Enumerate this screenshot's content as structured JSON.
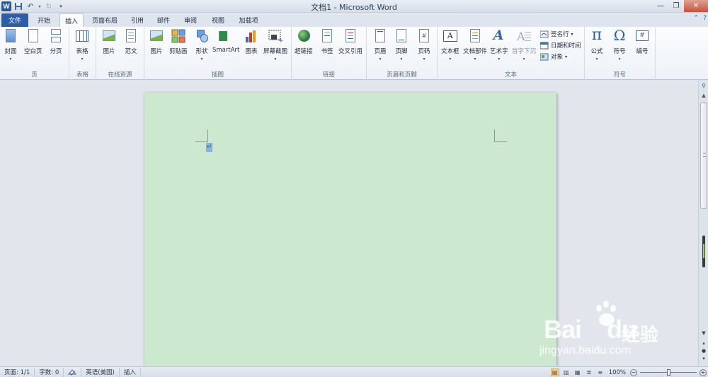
{
  "window": {
    "title": "文档1 - Microsoft Word",
    "app_logo": "W",
    "controls": [
      "—",
      "❐",
      "✕"
    ]
  },
  "tabs": {
    "file": "文件",
    "items": [
      "开始",
      "插入",
      "页面布局",
      "引用",
      "邮件",
      "审阅",
      "视图",
      "加载项"
    ],
    "active": "插入"
  },
  "ribbon": {
    "groups": {
      "page": "页",
      "table": "表格",
      "online": "在线资源",
      "illustrations": "插图",
      "links": "链接",
      "header_footer": "页眉和页脚",
      "text": "文本",
      "symbols": "符号"
    },
    "buttons": {
      "cover": "封面",
      "blank_page": "空白页",
      "page_break": "分页",
      "table": "表格",
      "online_picture": "图片",
      "template": "范文",
      "picture": "图片",
      "clip_art": "剪贴画",
      "shapes": "形状",
      "smartart": "SmartArt",
      "chart": "图表",
      "screenshot": "屏幕截图",
      "hyperlink": "超链接",
      "bookmark": "书签",
      "cross_ref": "交叉引用",
      "header": "页眉",
      "footer": "页脚",
      "page_number": "页码",
      "text_box": "文本框",
      "quick_parts": "文档部件",
      "wordart": "艺术字",
      "drop_cap": "首字下沉",
      "signature": "签名行",
      "date_time": "日期和时间",
      "object": "对象",
      "equation": "公式",
      "symbol": "符号",
      "number": "编号"
    },
    "dropdown_arrow": "▾"
  },
  "document": {
    "paragraph_mark": "↵",
    "page_color": "#cce8cf"
  },
  "status": {
    "page": "页面: 1/1",
    "words": "字数: 0",
    "language": "英语(美国)",
    "mode": "插入",
    "zoom": "100%"
  },
  "watermark": {
    "brand": "Bai",
    "brand_tail": "du",
    "cn": "经验",
    "url": "jingyan.baidu.com"
  },
  "colors": {
    "accent": "#2a5ea6",
    "page": "#cce8cf"
  }
}
